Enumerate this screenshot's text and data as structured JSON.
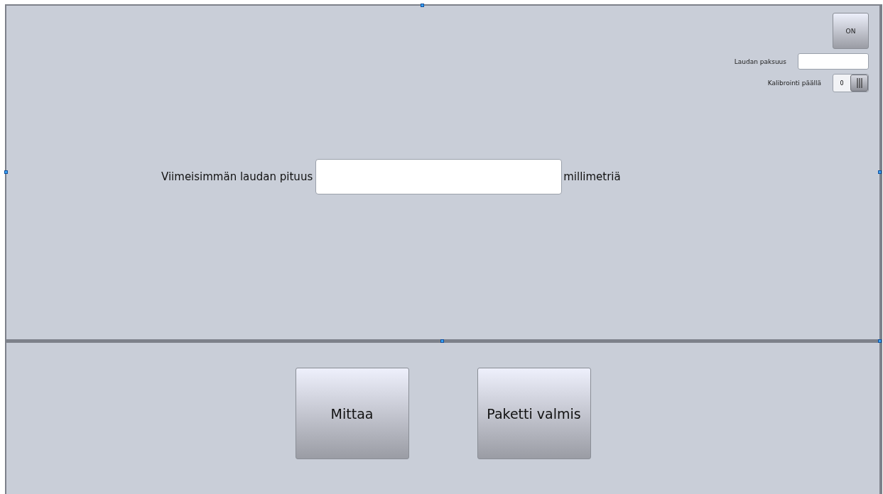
{
  "power_button": {
    "label": "ON"
  },
  "thickness": {
    "label": "Laudan paksuus"
  },
  "calibration": {
    "label": "Kalibrointi päällä",
    "value": "0"
  },
  "length": {
    "label": "Viimeisimmän laudan pituus",
    "unit": "millimetriä"
  },
  "buttons": [
    {
      "label": "Mittaa"
    },
    {
      "label": "Paketti valmis"
    }
  ]
}
